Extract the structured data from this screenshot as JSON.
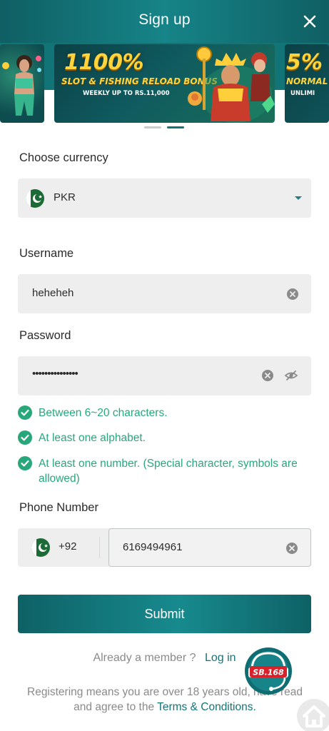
{
  "header": {
    "title": "Sign up"
  },
  "banner": {
    "left_card_alt": "promo-girl",
    "main": {
      "headline": "1100%",
      "subtitle": "SLOT & FISHING RELOAD BONUS",
      "note": "WEEKLY UP TO RS.11,000"
    },
    "right_card": {
      "headline": "5%",
      "subtitle": "NORMAL",
      "note": "UNLIMI"
    },
    "active_slide": 2,
    "slide_count": 2
  },
  "currency": {
    "label": "Choose currency",
    "value": "PKR"
  },
  "username": {
    "label": "Username",
    "value": "heheheh"
  },
  "password": {
    "label": "Password",
    "value": "•••••••••••••••"
  },
  "password_rules": [
    "Between 6~20 characters.",
    "At least one alphabet.",
    "At least one number. (Special character, symbols are allowed)"
  ],
  "phone": {
    "label": "Phone Number",
    "country_code": "+92",
    "value": "6169494961"
  },
  "submit": {
    "label": "Submit"
  },
  "footer": {
    "member_text": "Already a member ?",
    "login_label": "Log in",
    "terms_prefix": "Registering means you are over 18 years old, have read and agree to the",
    "terms_link": "Terms & Conditions."
  },
  "support": {
    "badge_text": "SB.168"
  },
  "colors": {
    "brand": "#137478",
    "success": "#28a87a",
    "field_bg": "#eeeeee"
  }
}
